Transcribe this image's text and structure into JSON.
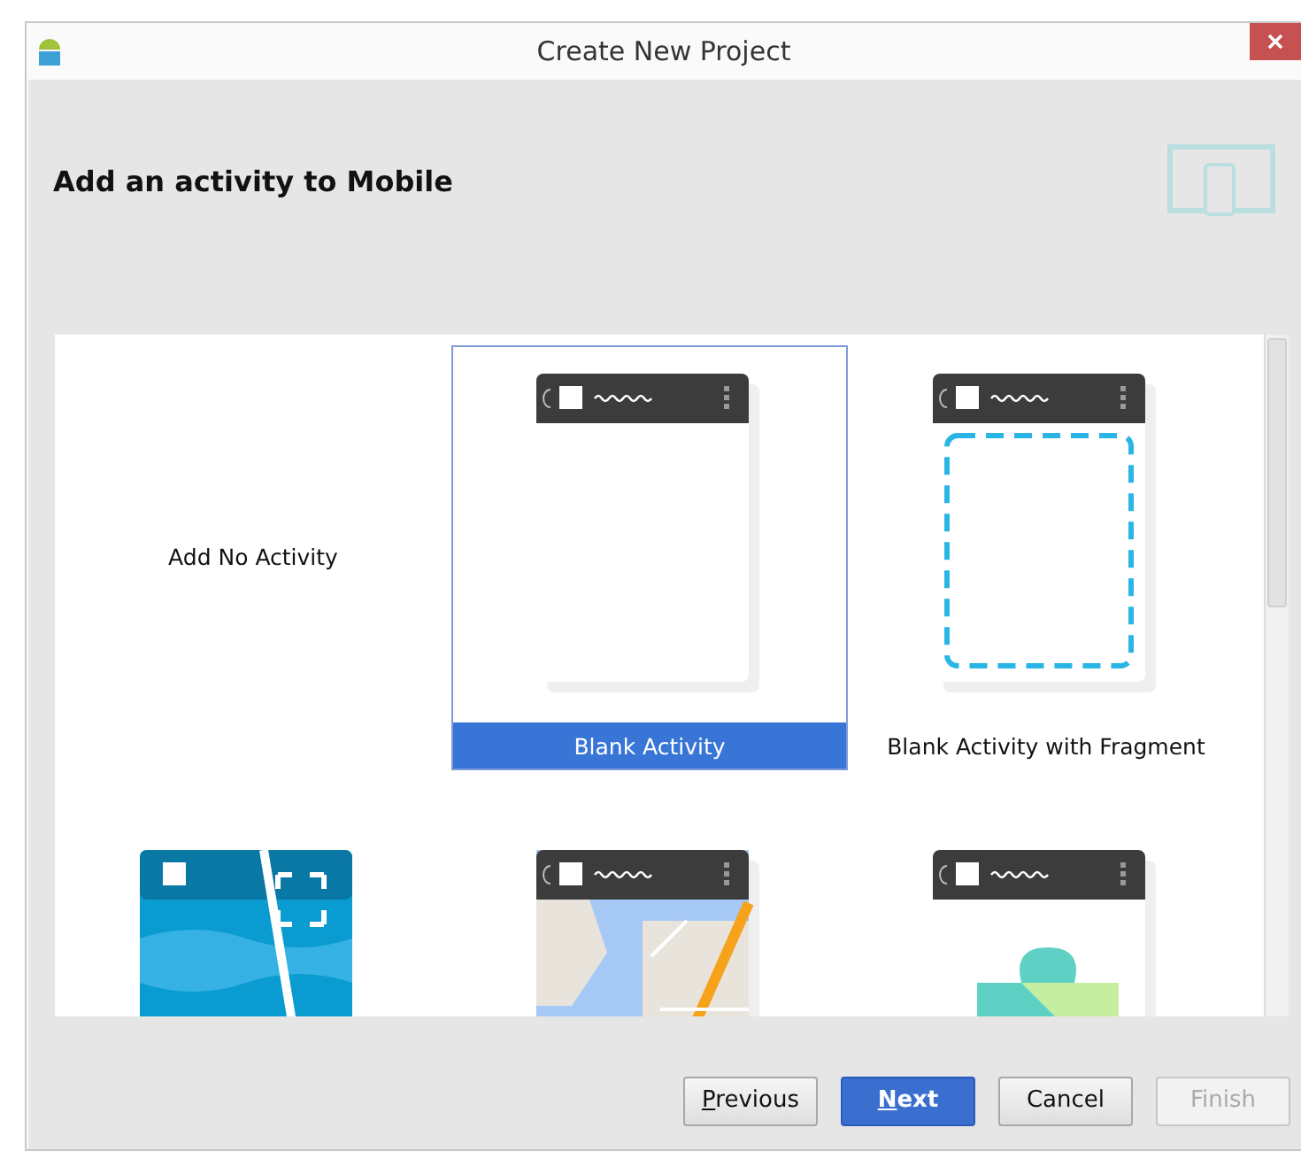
{
  "window": {
    "title": "Create New Project"
  },
  "header": {
    "title": "Add an activity to Mobile"
  },
  "templates": [
    {
      "kind": "none",
      "label": "Add No Activity",
      "selected": false
    },
    {
      "kind": "blank",
      "label": "Blank Activity",
      "selected": true
    },
    {
      "kind": "fragment",
      "label": "Blank Activity with Fragment",
      "selected": false
    },
    {
      "kind": "fullscreen",
      "selected": false
    },
    {
      "kind": "map",
      "selected": false
    },
    {
      "kind": "play",
      "selected": false
    }
  ],
  "buttons": [
    {
      "label": "Previous",
      "mnemonic": true,
      "primary": false,
      "disabled": false
    },
    {
      "label": "Next",
      "mnemonic": true,
      "primary": true,
      "disabled": false
    },
    {
      "label": "Cancel",
      "mnemonic": false,
      "primary": false,
      "disabled": false
    },
    {
      "label": "Finish",
      "mnemonic": false,
      "primary": false,
      "disabled": true
    }
  ]
}
